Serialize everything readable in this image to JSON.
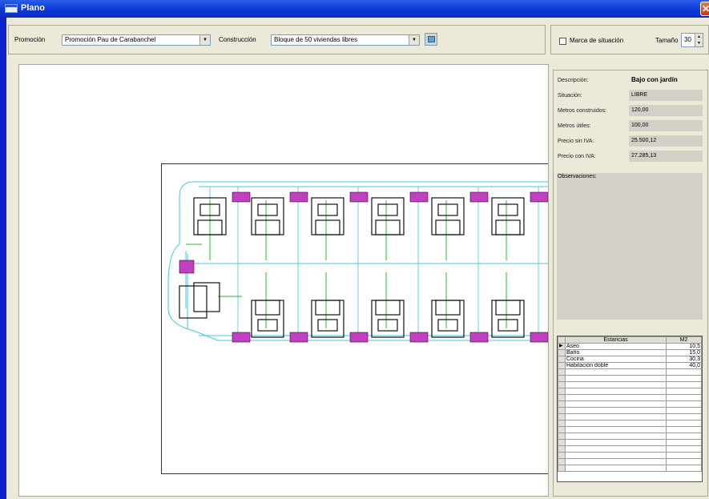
{
  "window": {
    "title": "Plano",
    "close_glyph": "✕"
  },
  "toolbar": {
    "promocion_label": "Promoción",
    "promocion_value": "Promoción Pau de Carabanchel",
    "construccion_label": "Construcción",
    "construccion_value": "Bloque de 50 viviendas libres",
    "dropdown_glyph": "▼",
    "marca_label": "Marca de situación",
    "tamano_label": "Tamaño",
    "tamano_value": "30",
    "spin_up": "▲",
    "spin_down": "▼"
  },
  "info": {
    "fields": [
      {
        "label": "Descripción:",
        "value": "Bajo con jardín"
      },
      {
        "label": "Situación:",
        "value": "LIBRE"
      },
      {
        "label": "Metros construidos:",
        "value": "120,00"
      },
      {
        "label": "Metros útiles:",
        "value": "100,00"
      },
      {
        "label": "Precio sin IVA:",
        "value": "25.500,12"
      },
      {
        "label": "Precio con IVA:",
        "value": "27.285,13"
      }
    ],
    "observaciones_label": "Observaciones:"
  },
  "estancias": {
    "headers": [
      "Estancias",
      "M2"
    ],
    "indicator": "▶",
    "rows": [
      {
        "name": "Aseo",
        "m2": "10,5"
      },
      {
        "name": "Baño",
        "m2": "15,0"
      },
      {
        "name": "Cocina",
        "m2": "30,3"
      },
      {
        "name": "Habitación doble",
        "m2": "40,0"
      }
    ]
  },
  "colors": {
    "title_bar": "#0a36d8",
    "plan_cyan": "#40c8e0",
    "plan_green": "#20c020",
    "plan_magenta": "#c040c0"
  }
}
